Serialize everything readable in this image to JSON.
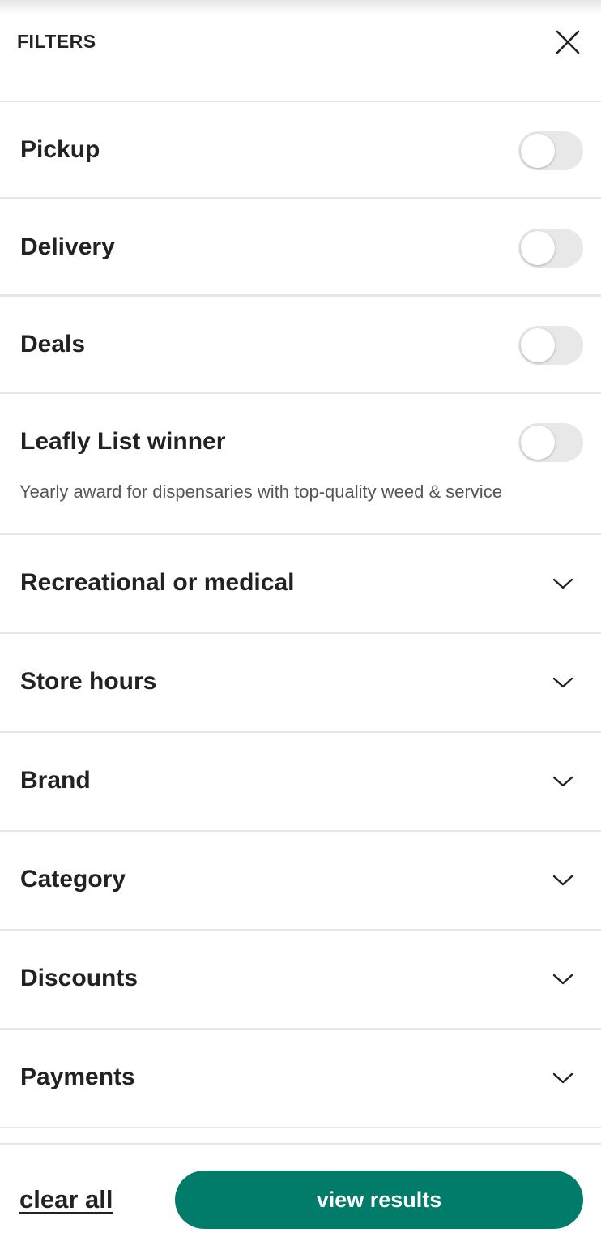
{
  "header": {
    "title": "FILTERS",
    "close_icon": "close-icon"
  },
  "toggles": [
    {
      "label": "Pickup",
      "on": false
    },
    {
      "label": "Delivery",
      "on": false
    },
    {
      "label": "Deals",
      "on": false
    },
    {
      "label": "Leafly List winner",
      "description": "Yearly award for dispensaries with top-quality weed & service",
      "on": false
    }
  ],
  "sections": [
    {
      "label": "Recreational or medical",
      "icon": "chevron-down-icon"
    },
    {
      "label": "Store hours",
      "icon": "chevron-down-icon"
    },
    {
      "label": "Brand",
      "icon": "chevron-down-icon"
    },
    {
      "label": "Category",
      "icon": "chevron-down-icon"
    },
    {
      "label": "Discounts",
      "icon": "chevron-down-icon"
    },
    {
      "label": "Payments",
      "icon": "chevron-down-icon"
    }
  ],
  "footer": {
    "clear_all_label": "clear all",
    "view_results_label": "view results"
  },
  "colors": {
    "primary": "#017c6b",
    "divider": "#e6e6e6",
    "toggle_off": "#e8e8e8",
    "text": "#222222"
  }
}
